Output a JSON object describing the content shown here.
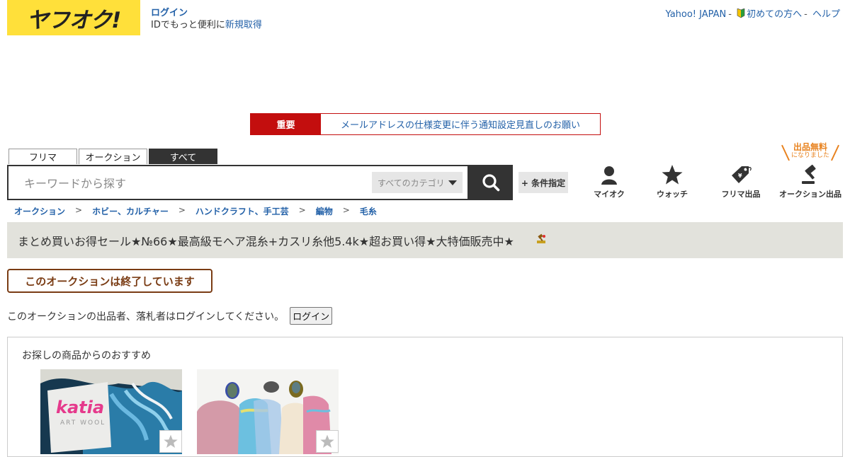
{
  "header": {
    "logo_text": "ヤフオク!",
    "login_label": "ログイン",
    "id_text": "IDでもっと便利に",
    "signup_label": "新規取得",
    "links": [
      "Yahoo! JAPAN",
      "初めての方へ",
      "ヘルプ"
    ]
  },
  "notice": {
    "badge": "重要",
    "message": "メールアドレスの仕様変更に伴う通知設定見直しのお願い"
  },
  "search": {
    "tabs": [
      "フリマ",
      "オークション",
      "すべて"
    ],
    "active_tab": "すべて",
    "placeholder": "キーワードから探す",
    "category": "すべてのカテゴリ",
    "condition_label": "+ 条件指定"
  },
  "actions": {
    "free_badge_main": "出品無料",
    "free_badge_sub": "になりました",
    "items": [
      "マイオク",
      "ウォッチ",
      "フリマ出品",
      "オークション出品"
    ]
  },
  "breadcrumb": [
    "オークション",
    "ホビー、カルチャー",
    "ハンドクラフト、手工芸",
    "編物",
    "毛糸"
  ],
  "item": {
    "title": "まとめ買いお得セール★№66★最高級モヘア混糸+カスリ糸他5.4k★超お買い得★大特価販売中★"
  },
  "status": {
    "ended": "このオークションは終了しています",
    "note": "このオークションの出品者、落札者はログインしてください。",
    "login_button": "ログイン"
  },
  "recommend": {
    "heading": "お探しの商品からのおすすめ",
    "card1_brand": "katia",
    "card1_sub": "ART WOOL"
  },
  "colors": {
    "brand_yellow": "#ffe03a",
    "alert_red": "#c30e0e",
    "link_blue": "#2361a8",
    "ended_brown": "#7a3c14"
  }
}
